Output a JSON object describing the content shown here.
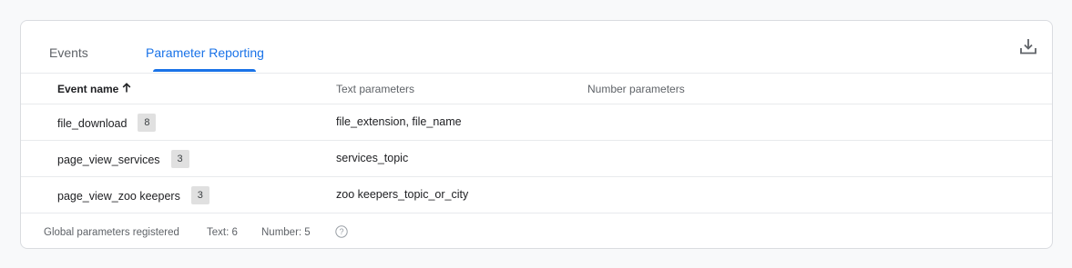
{
  "tabs": {
    "events_label": "Events",
    "parameter_reporting_label": "Parameter Reporting",
    "active": "Parameter Reporting"
  },
  "toolbar": {
    "download_icon": "download-icon"
  },
  "table": {
    "columns": {
      "event_name": "Event name",
      "text_parameters": "Text parameters",
      "number_parameters": "Number parameters"
    },
    "sort_icon": "arrow-up-icon",
    "rows": [
      {
        "event_name": "file_download",
        "count": "8",
        "text_parameters": "file_extension, file_name",
        "number_parameters": ""
      },
      {
        "event_name": "page_view_services",
        "count": "3",
        "text_parameters": "services_topic",
        "number_parameters": ""
      },
      {
        "event_name": "page_view_zoo keepers",
        "count": "3",
        "text_parameters": "zoo keepers_topic_or_city",
        "number_parameters": ""
      }
    ]
  },
  "footer": {
    "label": "Global parameters registered",
    "text_count": "Text: 6",
    "number_count": "Number: 5",
    "help_icon": "help-icon"
  },
  "colors": {
    "accent": "#1a73e8",
    "border": "#dadce0",
    "badge_bg": "#e0e0e0"
  }
}
